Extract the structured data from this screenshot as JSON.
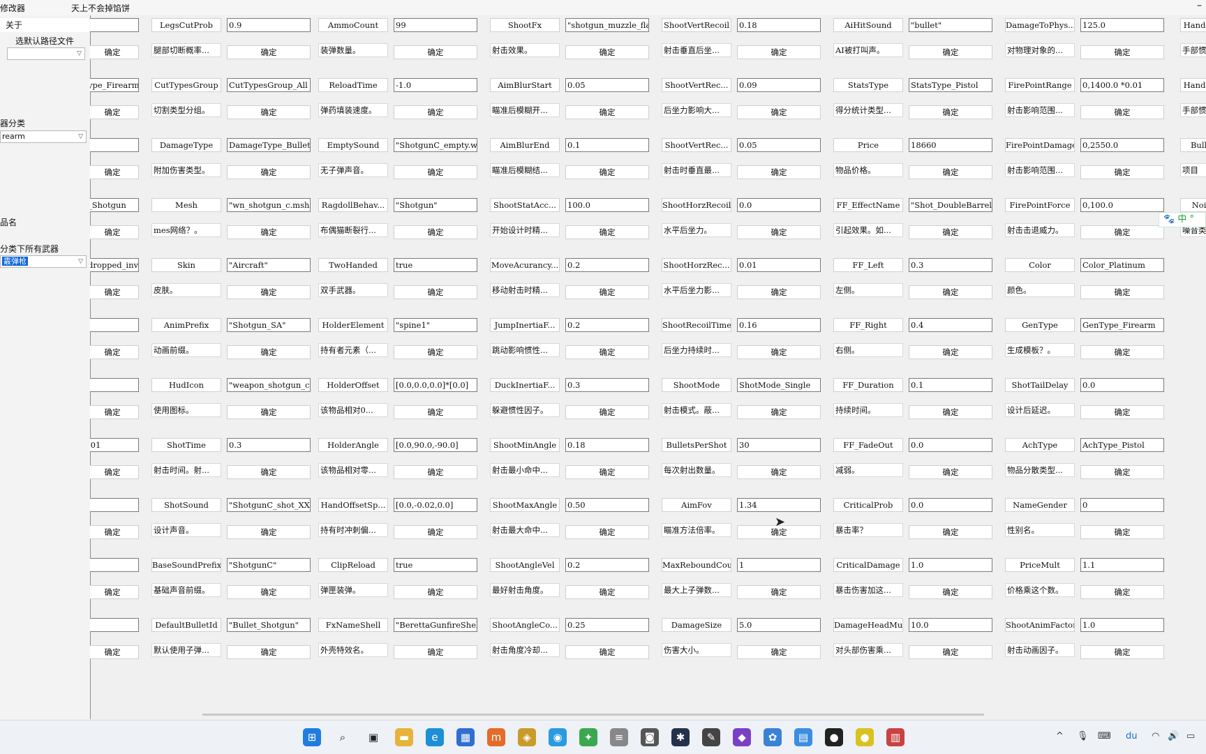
{
  "window": {
    "app_name": "修改器",
    "title": "天上不会掉馅饼",
    "minimize": "–"
  },
  "left_panel": {
    "about": "关于",
    "path_button": "选默认路径文件",
    "category_label": "器分类",
    "category_value": "rearm",
    "item_name_label": "品名",
    "all_weapons_label": "分类下所有武器",
    "weapon_value": "霰弹枪"
  },
  "btn_label": "确定",
  "columns": [
    {
      "rows": [
        {
          "name": "",
          "value": "",
          "desc": ""
        },
        {
          "name": "",
          "value": "ype_Firearm",
          "desc": ""
        },
        {
          "name": "",
          "value": "",
          "desc": ""
        },
        {
          "name": "",
          "value": "_Shotgun",
          "desc": ""
        },
        {
          "name": "",
          "value": "dropped_inv",
          "desc": ""
        },
        {
          "name": "",
          "value": "",
          "desc": ""
        },
        {
          "name": "",
          "value": "",
          "desc": ""
        },
        {
          "name": "",
          "value": ".01",
          "desc": ""
        },
        {
          "name": "",
          "value": "",
          "desc": ""
        },
        {
          "name": "",
          "value": "",
          "desc": ""
        },
        {
          "name": "",
          "value": "",
          "desc": ""
        }
      ]
    },
    {
      "rows": [
        {
          "name": "LegsCutProb",
          "value": "0.9",
          "desc": "腿部切断概率..."
        },
        {
          "name": "CutTypesGroup",
          "value": "CutTypesGroup_All",
          "desc": "切割类型分组。"
        },
        {
          "name": "DamageType",
          "value": "DamageType_Bullet",
          "desc": "附加伤害类型。"
        },
        {
          "name": "Mesh",
          "value": "\"wn_shotgun_c.msh\"",
          "desc": "mes网络？。"
        },
        {
          "name": "Skin",
          "value": "\"Aircraft\"",
          "desc": "皮肤。"
        },
        {
          "name": "AnimPrefix",
          "value": "\"Shotgun_SA\"",
          "desc": "动画前缀。"
        },
        {
          "name": "HudIcon",
          "value": "\"weapon_shotgun_c\"",
          "desc": "使用图标。"
        },
        {
          "name": "ShotTime",
          "value": "0.3",
          "desc": "射击时间。射..."
        },
        {
          "name": "ShotSound",
          "value": "\"ShotgunC_shot_XX.w",
          "desc": "设计声音。"
        },
        {
          "name": "BaseSoundPrefix",
          "value": "\"ShotgunC\"",
          "desc": "基础声音前缀。"
        },
        {
          "name": "DefaultBulletId",
          "value": "\"Bullet_Shotgun\"",
          "desc": "默认使用子弹..."
        }
      ]
    },
    {
      "rows": [
        {
          "name": "AmmoCount",
          "value": "99",
          "desc": "装弹数量。"
        },
        {
          "name": "ReloadTime",
          "value": "-1.0",
          "desc": "弹药填装速度。"
        },
        {
          "name": "EmptySound",
          "value": "\"ShotgunC_empty.wav",
          "desc": "无子弹声音。"
        },
        {
          "name": "RagdollBehav...",
          "value": "\"Shotgun\"",
          "desc": "布偶猫断裂行..."
        },
        {
          "name": "TwoHanded",
          "value": "true",
          "desc": "双手武器。"
        },
        {
          "name": "HolderElement",
          "value": "\"spine1\"",
          "desc": "持有者元素（..."
        },
        {
          "name": "HolderOffset",
          "value": "[0.0,0.0,0.0]*[0.0]",
          "desc": "该物品相对0..."
        },
        {
          "name": "HolderAngle",
          "value": "[0.0,90.0,-90.0]",
          "desc": "该物品相对零..."
        },
        {
          "name": "HandOffsetSp...",
          "value": "[0.0,-0.02,0.0]",
          "desc": "持有时冲刺偏..."
        },
        {
          "name": "ClipReload",
          "value": "true",
          "desc": "弹匣装弹。"
        },
        {
          "name": "FxNameShell",
          "value": "\"BerettaGunfireShel",
          "desc": "外壳特效名。"
        }
      ]
    },
    {
      "rows": [
        {
          "name": "ShootFx",
          "value": "\"shotgun_muzzle_fla",
          "desc": "射击效果。"
        },
        {
          "name": "AimBlurStart",
          "value": "0.05",
          "desc": "瞄准后模糊开..."
        },
        {
          "name": "AimBlurEnd",
          "value": "0.1",
          "desc": "瞄准后模糊结..."
        },
        {
          "name": "ShootStatAcc...",
          "value": "100.0",
          "desc": "开始设计时精..."
        },
        {
          "name": "MoveAcurancy...",
          "value": "0.2",
          "desc": "移动射击时精..."
        },
        {
          "name": "JumpInertiaF...",
          "value": "0.2",
          "desc": "跳动影响惯性..."
        },
        {
          "name": "DuckInertiaF...",
          "value": "0.3",
          "desc": "躲避惯性因子。"
        },
        {
          "name": "ShootMinAngle",
          "value": "0.18",
          "desc": "射击最小命中..."
        },
        {
          "name": "ShootMaxAngle",
          "value": "0.50",
          "desc": "射击最大命中..."
        },
        {
          "name": "ShootAngleVel",
          "value": "0.2",
          "desc": "最好射击角度。"
        },
        {
          "name": "ShootAngleCo...",
          "value": "0.25",
          "desc": "射击角度冷却..."
        }
      ]
    },
    {
      "rows": [
        {
          "name": "ShootVertRecoil",
          "value": "0.18",
          "desc": "射击垂直后坐..."
        },
        {
          "name": "ShootVertRec...",
          "value": "0.09",
          "desc": "后坐力影响大..."
        },
        {
          "name": "ShootVertRec...",
          "value": "0.05",
          "desc": "射击时垂直最..."
        },
        {
          "name": "ShootHorzRecoil",
          "value": "0.0",
          "desc": "水平后坐力。"
        },
        {
          "name": "ShootHorzRec...",
          "value": "0.01",
          "desc": "水平后坐力影..."
        },
        {
          "name": "ShootRecoilTime",
          "value": "0.16",
          "desc": "后坐力持续时..."
        },
        {
          "name": "ShootMode",
          "value": "ShotMode_Single",
          "desc": "射击模式。蔽..."
        },
        {
          "name": "BulletsPerShot",
          "value": "30",
          "desc": "每次射出数量。"
        },
        {
          "name": "AimFov",
          "value": "1.34",
          "desc": "瞄准方法倍率。"
        },
        {
          "name": "MaxReboundCount",
          "value": "1",
          "desc": "最大上子弹数..."
        },
        {
          "name": "DamageSize",
          "value": "5.0",
          "desc": "伤害大小。"
        }
      ]
    },
    {
      "rows": [
        {
          "name": "AiHitSound",
          "value": "\"bullet\"",
          "desc": "AI被打叫声。"
        },
        {
          "name": "StatsType",
          "value": "StatsType_Pistol",
          "desc": "得分统计类型..."
        },
        {
          "name": "Price",
          "value": "18660",
          "desc": "物品价格。"
        },
        {
          "name": "FF_EffectName",
          "value": "\"Shot_DoubleBarrel\"",
          "desc": "引起效果。如..."
        },
        {
          "name": "FF_Left",
          "value": "0.3",
          "desc": "左侧。"
        },
        {
          "name": "FF_Right",
          "value": "0.4",
          "desc": "右侧。"
        },
        {
          "name": "FF_Duration",
          "value": "0.1",
          "desc": "持续时间。"
        },
        {
          "name": "FF_FadeOut",
          "value": "0.0",
          "desc": "减弱。"
        },
        {
          "name": "CriticalProb",
          "value": "0.0",
          "desc": "暴击率？"
        },
        {
          "name": "CriticalDamage",
          "value": "1.0",
          "desc": "暴击伤害加这..."
        },
        {
          "name": "DamageHeadMult",
          "value": "10.0",
          "desc": "对头部伤害乘..."
        }
      ]
    },
    {
      "rows": [
        {
          "name": "DamageToPhys...",
          "value": "125.0",
          "desc": "对物理对象的..."
        },
        {
          "name": "FirePointRange",
          "value": "0,1400.0 *0.01",
          "desc": "射击影响范围..."
        },
        {
          "name": "FirePointDamage",
          "value": "0,2550.0",
          "desc": "射击影响范围..."
        },
        {
          "name": "FirePointForce",
          "value": "0,100.0",
          "desc": "射击击退威力。"
        },
        {
          "name": "Color",
          "value": "Color_Platinum",
          "desc": "颜色。"
        },
        {
          "name": "GenType",
          "value": "GenType_Firearm",
          "desc": "生成模板？。"
        },
        {
          "name": "ShotTailDelay",
          "value": "0.0",
          "desc": "设计后延迟。"
        },
        {
          "name": "AchType",
          "value": "AchType_Pistol",
          "desc": "物品分散类型..."
        },
        {
          "name": "NameGender",
          "value": "0",
          "desc": "性别名。"
        },
        {
          "name": "PriceMult",
          "value": "1.1",
          "desc": "价格乘这个数。"
        },
        {
          "name": "ShootAnimFactor",
          "value": "1.0",
          "desc": "射击动画因子。"
        }
      ]
    },
    {
      "rows": [
        {
          "name": "HandIne",
          "value": "",
          "desc": "手部惯"
        },
        {
          "name": "HandIne",
          "value": "",
          "desc": "手部惯"
        },
        {
          "name": "Bulle",
          "value": "",
          "desc": "项目"
        },
        {
          "name": "Nois",
          "value": "",
          "desc": "噪音类"
        }
      ]
    }
  ],
  "ime": {
    "text": "中 °"
  },
  "taskbar": {
    "tray_caret": "^",
    "lang": "du",
    "icons": [
      "windows-start-icon",
      "search-icon",
      "task-view-icon",
      "file-explorer-icon",
      "edge-browser-icon",
      "store-icon",
      "app-mi-icon",
      "app-game-icon",
      "app-chat-icon",
      "app-green-icon",
      "app-stack-icon",
      "camera-icon",
      "settings-gear-icon",
      "pen-icon",
      "visual-studio-icon",
      "app-flower-icon",
      "app-photos-icon",
      "app-red-icon",
      "app-yellow-icon",
      "app-active-window-icon"
    ]
  }
}
